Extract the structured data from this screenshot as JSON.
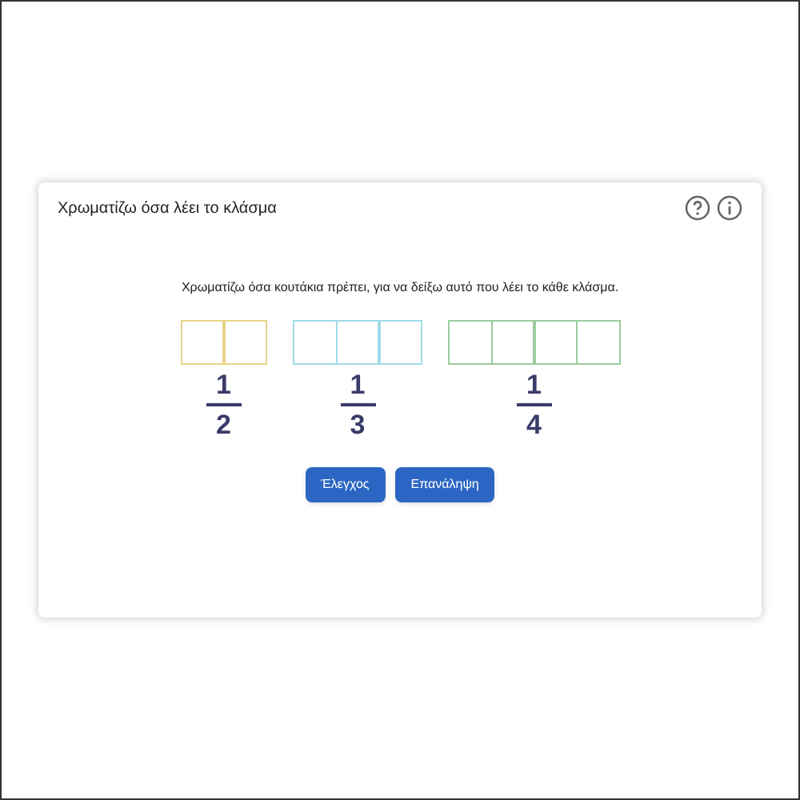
{
  "title": "Χρωματίζω όσα λέει το κλάσμα",
  "instruction": "Χρωματίζω όσα κουτάκια πρέπει, για να δείξω αυτό που λέει το κάθε κλάσμα.",
  "fractions": [
    {
      "numerator": "1",
      "denominator": "2",
      "color": "#e8d48a",
      "cells": [
        {
          "filled": false
        },
        {
          "filled": false
        }
      ]
    },
    {
      "numerator": "1",
      "denominator": "3",
      "color": "#9fdbe8",
      "cells": [
        {
          "filled": false
        },
        {
          "filled": false
        },
        {
          "filled": false
        }
      ]
    },
    {
      "numerator": "1",
      "denominator": "4",
      "color": "#9ccc9c",
      "cells": [
        {
          "filled": false
        },
        {
          "filled": false
        },
        {
          "filled": false
        },
        {
          "filled": false
        }
      ]
    }
  ],
  "buttons": [
    "Έλεγχος",
    "Επανάληψη"
  ]
}
